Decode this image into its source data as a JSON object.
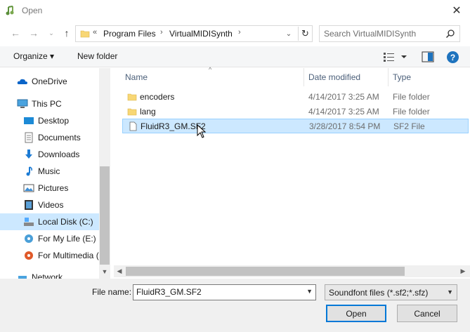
{
  "window": {
    "title": "Open",
    "close_glyph": "✕"
  },
  "nav_buttons": {
    "back": "←",
    "forward": "→",
    "recent": "⌄",
    "up": "↑"
  },
  "address": {
    "crumbs": [
      "«",
      "Program Files",
      "›",
      "VirtualMIDISynth",
      "›"
    ],
    "dropdown": "⌄",
    "refresh": "↻"
  },
  "search": {
    "placeholder": "Search VirtualMIDISynth"
  },
  "toolbar": {
    "organize": "Organize ▾",
    "new_folder": "New folder",
    "help": "?"
  },
  "nav": {
    "items": [
      {
        "label": "OneDrive",
        "icon": "cloud-icon"
      },
      {
        "label": "This PC",
        "icon": "computer-icon"
      },
      {
        "label": "Desktop",
        "icon": "desktop-icon"
      },
      {
        "label": "Documents",
        "icon": "documents-icon"
      },
      {
        "label": "Downloads",
        "icon": "downloads-icon"
      },
      {
        "label": "Music",
        "icon": "music-icon"
      },
      {
        "label": "Pictures",
        "icon": "pictures-icon"
      },
      {
        "label": "Videos",
        "icon": "videos-icon"
      },
      {
        "label": "Local Disk (C:)",
        "icon": "drive-icon"
      },
      {
        "label": "For My Life (E:)",
        "icon": "drive-icon"
      },
      {
        "label": "For Multimedia (",
        "icon": "drive-icon"
      },
      {
        "label": "Network",
        "icon": "network-icon"
      }
    ]
  },
  "columns": {
    "name": "Name",
    "date": "Date modified",
    "type": "Type"
  },
  "files": [
    {
      "name": "encoders",
      "date": "4/14/2017 3:25 AM",
      "type": "File folder",
      "icon": "folder-icon"
    },
    {
      "name": "lang",
      "date": "4/14/2017 3:25 AM",
      "type": "File folder",
      "icon": "folder-icon"
    },
    {
      "name": "FluidR3_GM.SF2",
      "date": "3/28/2017 8:54 PM",
      "type": "SF2 File",
      "icon": "file-icon"
    }
  ],
  "footer": {
    "file_name_label": "File name:",
    "file_name_value": "FluidR3_GM.SF2",
    "file_type": "Soundfont files (*.sf2;*.sfz)",
    "open": "Open",
    "cancel": "Cancel"
  },
  "colors": {
    "selection": "#cce8ff",
    "accent": "#0078d7",
    "folder": "#f8d775"
  }
}
